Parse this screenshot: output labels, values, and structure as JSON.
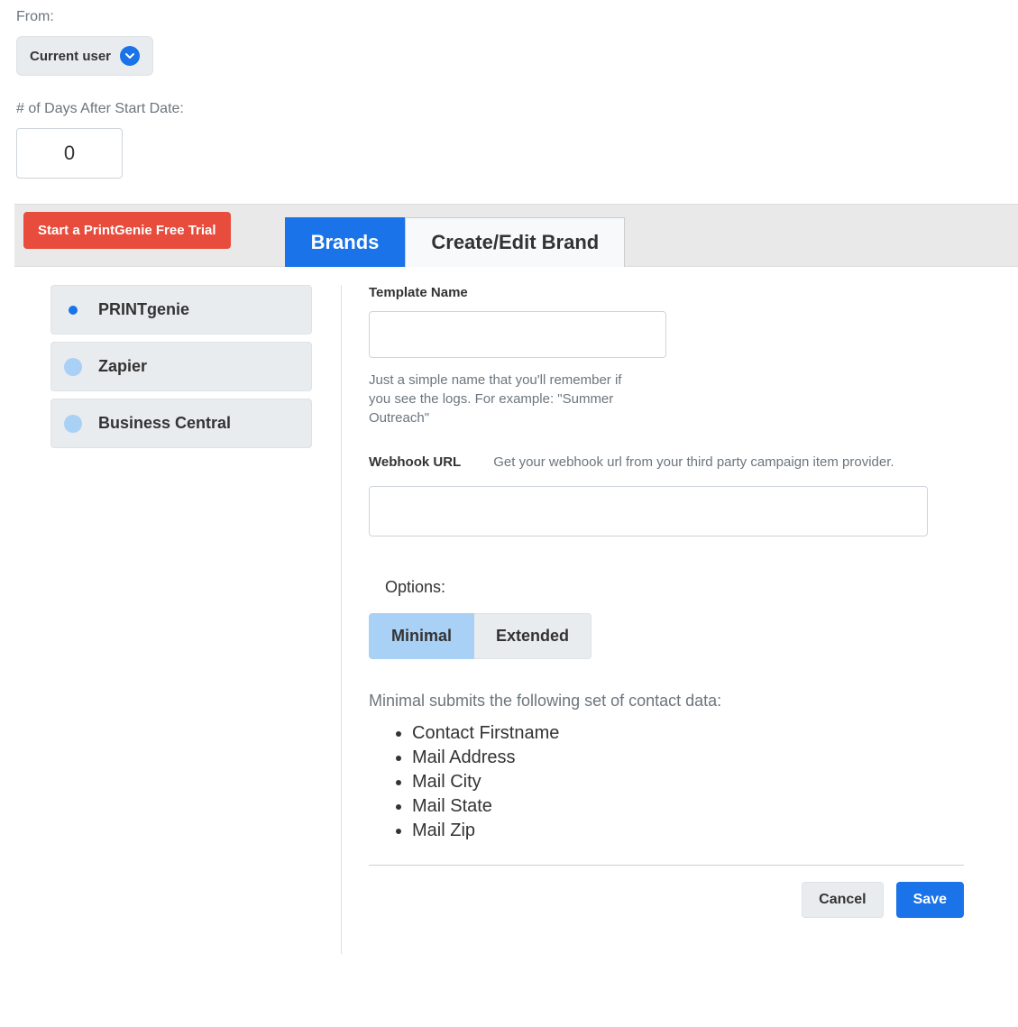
{
  "from": {
    "label": "From:",
    "value": "Current user"
  },
  "days_after": {
    "label": "# of Days After Start Date:",
    "value": "0"
  },
  "trial_button": "Start a PrintGenie Free Trial",
  "tabs": {
    "brands": "Brands",
    "create_edit": "Create/Edit Brand"
  },
  "brands": [
    {
      "label": "PRINTgenie",
      "selected": true
    },
    {
      "label": "Zapier",
      "selected": false
    },
    {
      "label": "Business Central",
      "selected": false
    }
  ],
  "form": {
    "template_name_label": "Template Name",
    "template_name_value": "",
    "template_name_help": "Just a simple name that you'll remember if you see the logs. For example: \"Summer Outreach\"",
    "webhook_label": "Webhook URL",
    "webhook_help": "Get your webhook url from your third party campaign item provider.",
    "webhook_value": "",
    "options_label": "Options:",
    "option_minimal": "Minimal",
    "option_extended": "Extended",
    "minimal_desc": "Minimal submits the following set of contact data:",
    "contact_fields": [
      "Contact Firstname",
      "Mail Address",
      "Mail City",
      "Mail State",
      "Mail Zip"
    ],
    "cancel": "Cancel",
    "save": "Save"
  }
}
